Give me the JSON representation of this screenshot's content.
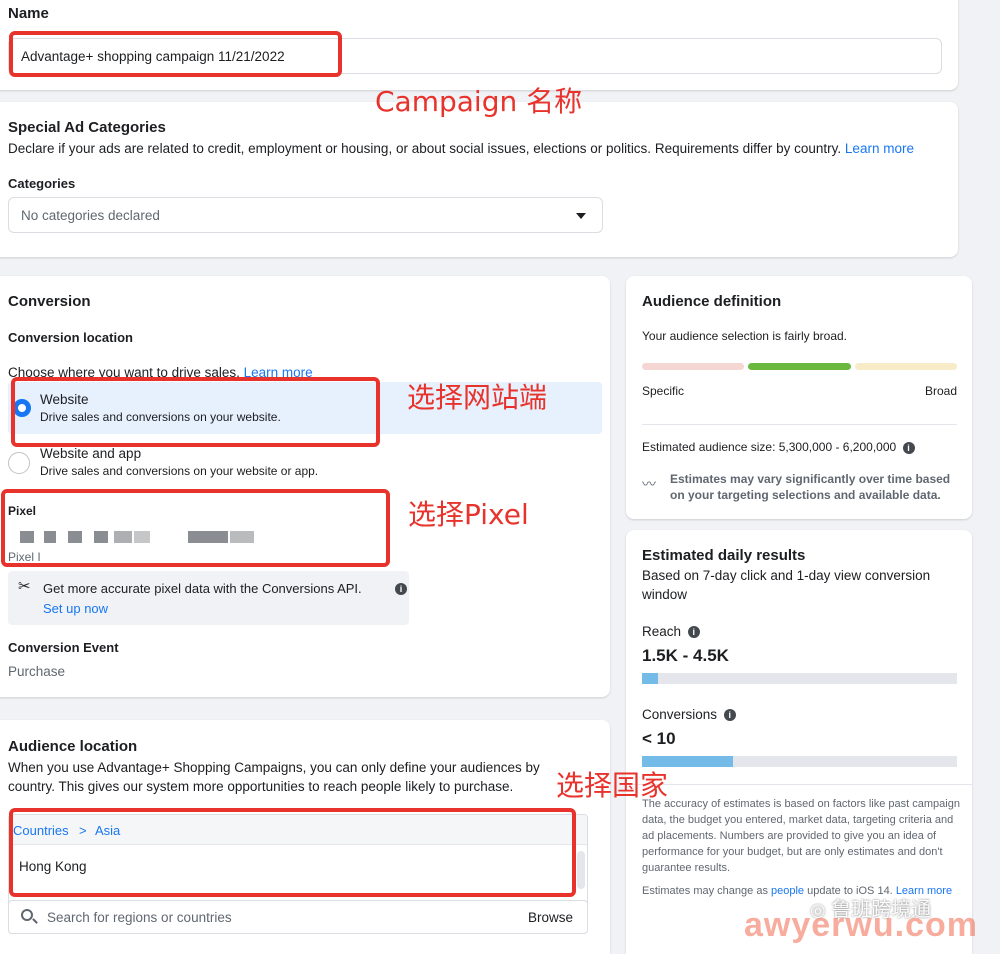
{
  "name_section": {
    "label": "Name",
    "value": "Advantage+ shopping campaign 11/21/2022"
  },
  "special_ad": {
    "title": "Special Ad Categories",
    "description": "Declare if your ads are related to credit, employment or housing, or about social issues, elections or politics. Requirements differ by country.",
    "learn_more": "Learn more",
    "categories_label": "Categories",
    "categories_value": "No categories declared"
  },
  "conversion": {
    "title": "Conversion",
    "location_label": "Conversion location",
    "choose_text": "Choose where you want to drive sales.",
    "learn_more": "Learn more",
    "options": [
      {
        "title": "Website",
        "desc": "Drive sales and conversions on your website.",
        "selected": true
      },
      {
        "title": "Website and app",
        "desc": "Drive sales and conversions on your website or app.",
        "selected": false
      }
    ],
    "pixel_label": "Pixel",
    "pixel_sub": "Pixel I",
    "api_tip": "Get more accurate pixel data with the Conversions API.",
    "setup": "Set up now",
    "event_label": "Conversion Event",
    "event_value": "Purchase"
  },
  "audience_location": {
    "title": "Audience location",
    "description": "When you use Advantage+ Shopping Campaigns, you can only define your audiences by country. This gives our system more opportunities to reach people likely to purchase.",
    "breadcrumb_countries": "Countries",
    "breadcrumb_sep": ">",
    "breadcrumb_region": "Asia",
    "selected_country": "Hong Kong",
    "search_placeholder": "Search for regions or countries",
    "browse": "Browse"
  },
  "audience_definition": {
    "title": "Audience definition",
    "summary": "Your audience selection is fairly broad.",
    "specific": "Specific",
    "broad": "Broad",
    "size_label": "Estimated audience size: 5,300,000 - 6,200,000",
    "estimate_note": "Estimates may vary significantly over time based on your targeting selections and available data.",
    "colors": {
      "specific": "#f6d6d2",
      "active": "#6bb83e",
      "broad": "#f7ecc7"
    }
  },
  "daily_results": {
    "title": "Estimated daily results",
    "subtitle": "Based on 7-day click and 1-day view conversion window",
    "reach_label": "Reach",
    "reach_value": "1.5K - 4.5K",
    "reach_fill": 0.05,
    "conv_label": "Conversions",
    "conv_value": "< 10",
    "conv_fill": 0.29,
    "accuracy_note": "The accuracy of estimates is based on factors like past campaign data, the budget you entered, market data, targeting criteria and ad placements. Numbers are provided to give you an idea of performance for your budget, but are only estimates and don't guarantee results.",
    "ios_pre": "Estimates may change as",
    "ios_link": "people",
    "ios_post": "update to iOS 14.",
    "ios_learn": "Learn more"
  },
  "annotations": {
    "campaign_name": "Campaign 名称",
    "website": "选择网站端",
    "pixel": "选择Pixel",
    "country": "选择国家"
  },
  "watermark": {
    "brand": "鲁班跨境通",
    "site": "awyerwu.com"
  }
}
